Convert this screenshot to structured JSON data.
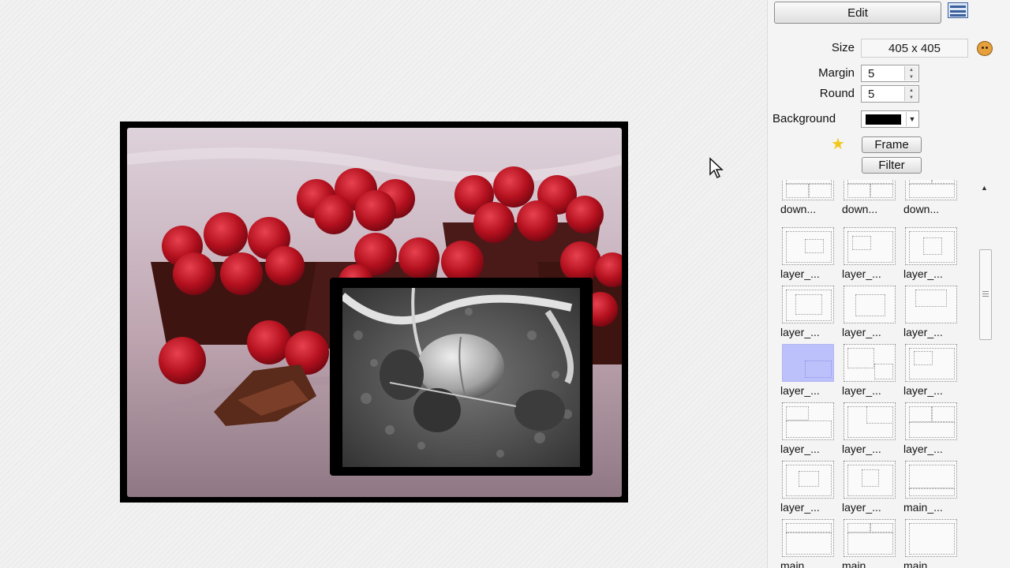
{
  "panel": {
    "edit_label": "Edit",
    "size_label": "Size",
    "size_value": "405 x 405",
    "margin_label": "Margin",
    "margin_value": "5",
    "round_label": "Round",
    "round_value": "5",
    "background_label": "Background",
    "background_color": "#000000",
    "frame_label": "Frame",
    "filter_label": "Filter"
  },
  "templates": [
    "down...",
    "down...",
    "down...",
    "layer_...",
    "layer_...",
    "layer_...",
    "layer_...",
    "layer_...",
    "layer_...",
    "layer_...",
    "layer_...",
    "layer_...",
    "layer_...",
    "layer_...",
    "layer_...",
    "layer_...",
    "layer_...",
    "main_...",
    "main_...",
    "main_...",
    "main_..."
  ],
  "selected_template_index": 9,
  "icons": {
    "layout": "layout-list-icon",
    "size": "smiley-icon",
    "favorite": "star-icon",
    "cursor": "mouse-pointer-icon"
  }
}
